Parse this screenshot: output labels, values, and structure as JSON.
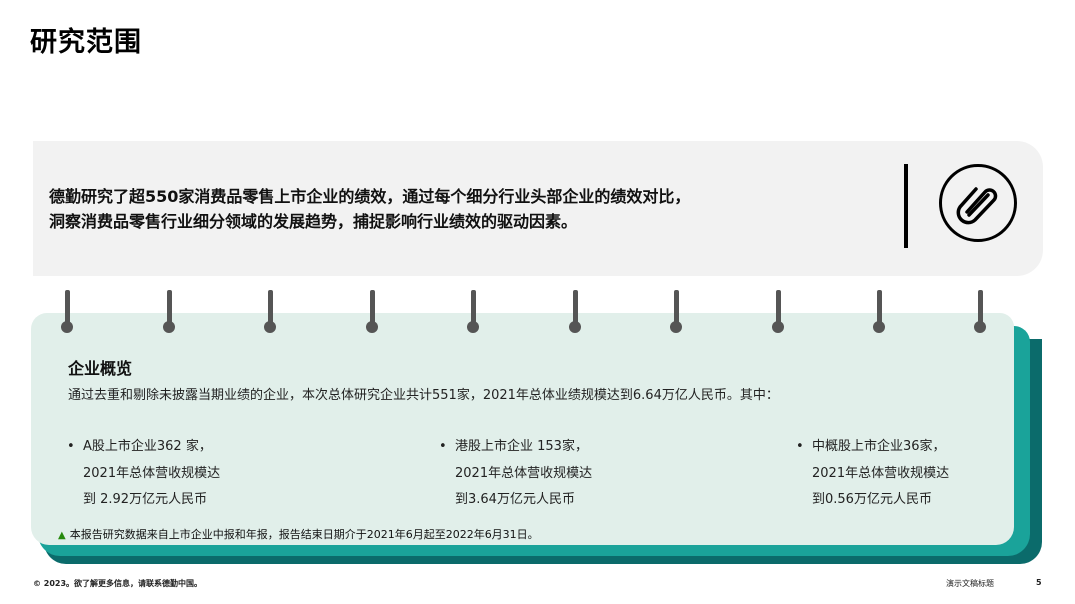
{
  "slide": {
    "title": "研究范围"
  },
  "intro": {
    "line1": "德勤研究了超550家消费品零售上市企业的绩效，通过每个细分行业头部企业的绩效对比，",
    "line2": "洞察消费品零售行业细分领域的发展趋势，捕捉影响行业绩效的驱动因素。",
    "icon": "paperclip-icon"
  },
  "overview": {
    "heading": "企业概览",
    "summary": "通过去重和剔除未披露当期业绩的企业，本次总体研究企业共计551家，2021年总体业绩规模达到6.64万亿人民币。其中：",
    "columns": [
      {
        "bullet": "•",
        "line1": "A股上市企业362 家，",
        "line2": "2021年总体营收规模达",
        "line3": "到 2.92万亿元人民币"
      },
      {
        "bullet": "•",
        "line1": "港股上市企业 153家，",
        "line2": "2021年总体营收规模达",
        "line3": "到3.64万亿元人民币"
      },
      {
        "bullet": "•",
        "line1": "中概股上市企业36家，",
        "line2": "2021年总体营收规模达",
        "line3": "到0.56万亿元人民币"
      }
    ],
    "note": "本报告研究数据来自上市企业中报和年报，报告结束日期介于2021年6月起至2022年6月31日。",
    "note_icon": "▲"
  },
  "footer": {
    "left": "© 2023。欲了解更多信息，请联系德勤中国。",
    "right": "演示文稿标题",
    "page": "5"
  },
  "colors": {
    "accent_green": "#26890d",
    "teal": "#1aa39a",
    "dark_teal": "#0b6b6b",
    "card_bg": "#e1efea",
    "intro_bg": "#f2f2f2"
  }
}
